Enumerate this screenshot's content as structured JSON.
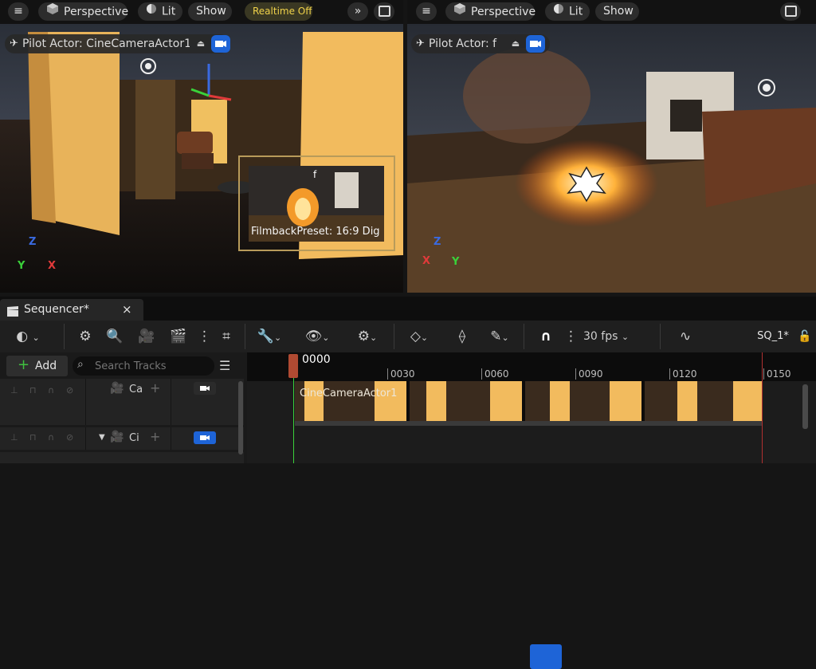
{
  "left_viewport": {
    "view_mode": "Perspective",
    "lighting": "Lit",
    "show_label": "Show",
    "realtime_label": "Realtime Off",
    "pilot_label": "Pilot Actor: CineCameraActor1",
    "pip_camera_name": "f",
    "pip_filmback": "FilmbackPreset: 16:9 Dig",
    "axes": {
      "z": "Z",
      "y": "Y",
      "x": "X"
    }
  },
  "right_viewport": {
    "view_mode": "Perspective",
    "lighting": "Lit",
    "show_label": "Show",
    "pilot_label": "Pilot Actor: f",
    "axes": {
      "z": "Z",
      "y": "Y",
      "x": "X"
    }
  },
  "sequencer": {
    "tab_label": "Sequencer*",
    "close_glyph": "×",
    "fps_label": "30 fps",
    "sequence_name": "SQ_1*",
    "add_label": "Add",
    "search_placeholder": "Search Tracks",
    "current_frame": "0000",
    "ruler_ticks": [
      "0030",
      "0060",
      "0090",
      "0120",
      "0150"
    ],
    "track_rows": [
      {
        "label": "Ca"
      },
      {
        "label": "Ci"
      }
    ],
    "clip_label": "CineCameraActor1"
  },
  "colors": {
    "accent_blue": "#1e64d7",
    "realtime_yellow": "#f0d24a",
    "playhead_red": "#b04a32",
    "axis_x": "#e03a3a",
    "axis_y": "#3ad13a",
    "axis_z": "#3a6ae0"
  }
}
